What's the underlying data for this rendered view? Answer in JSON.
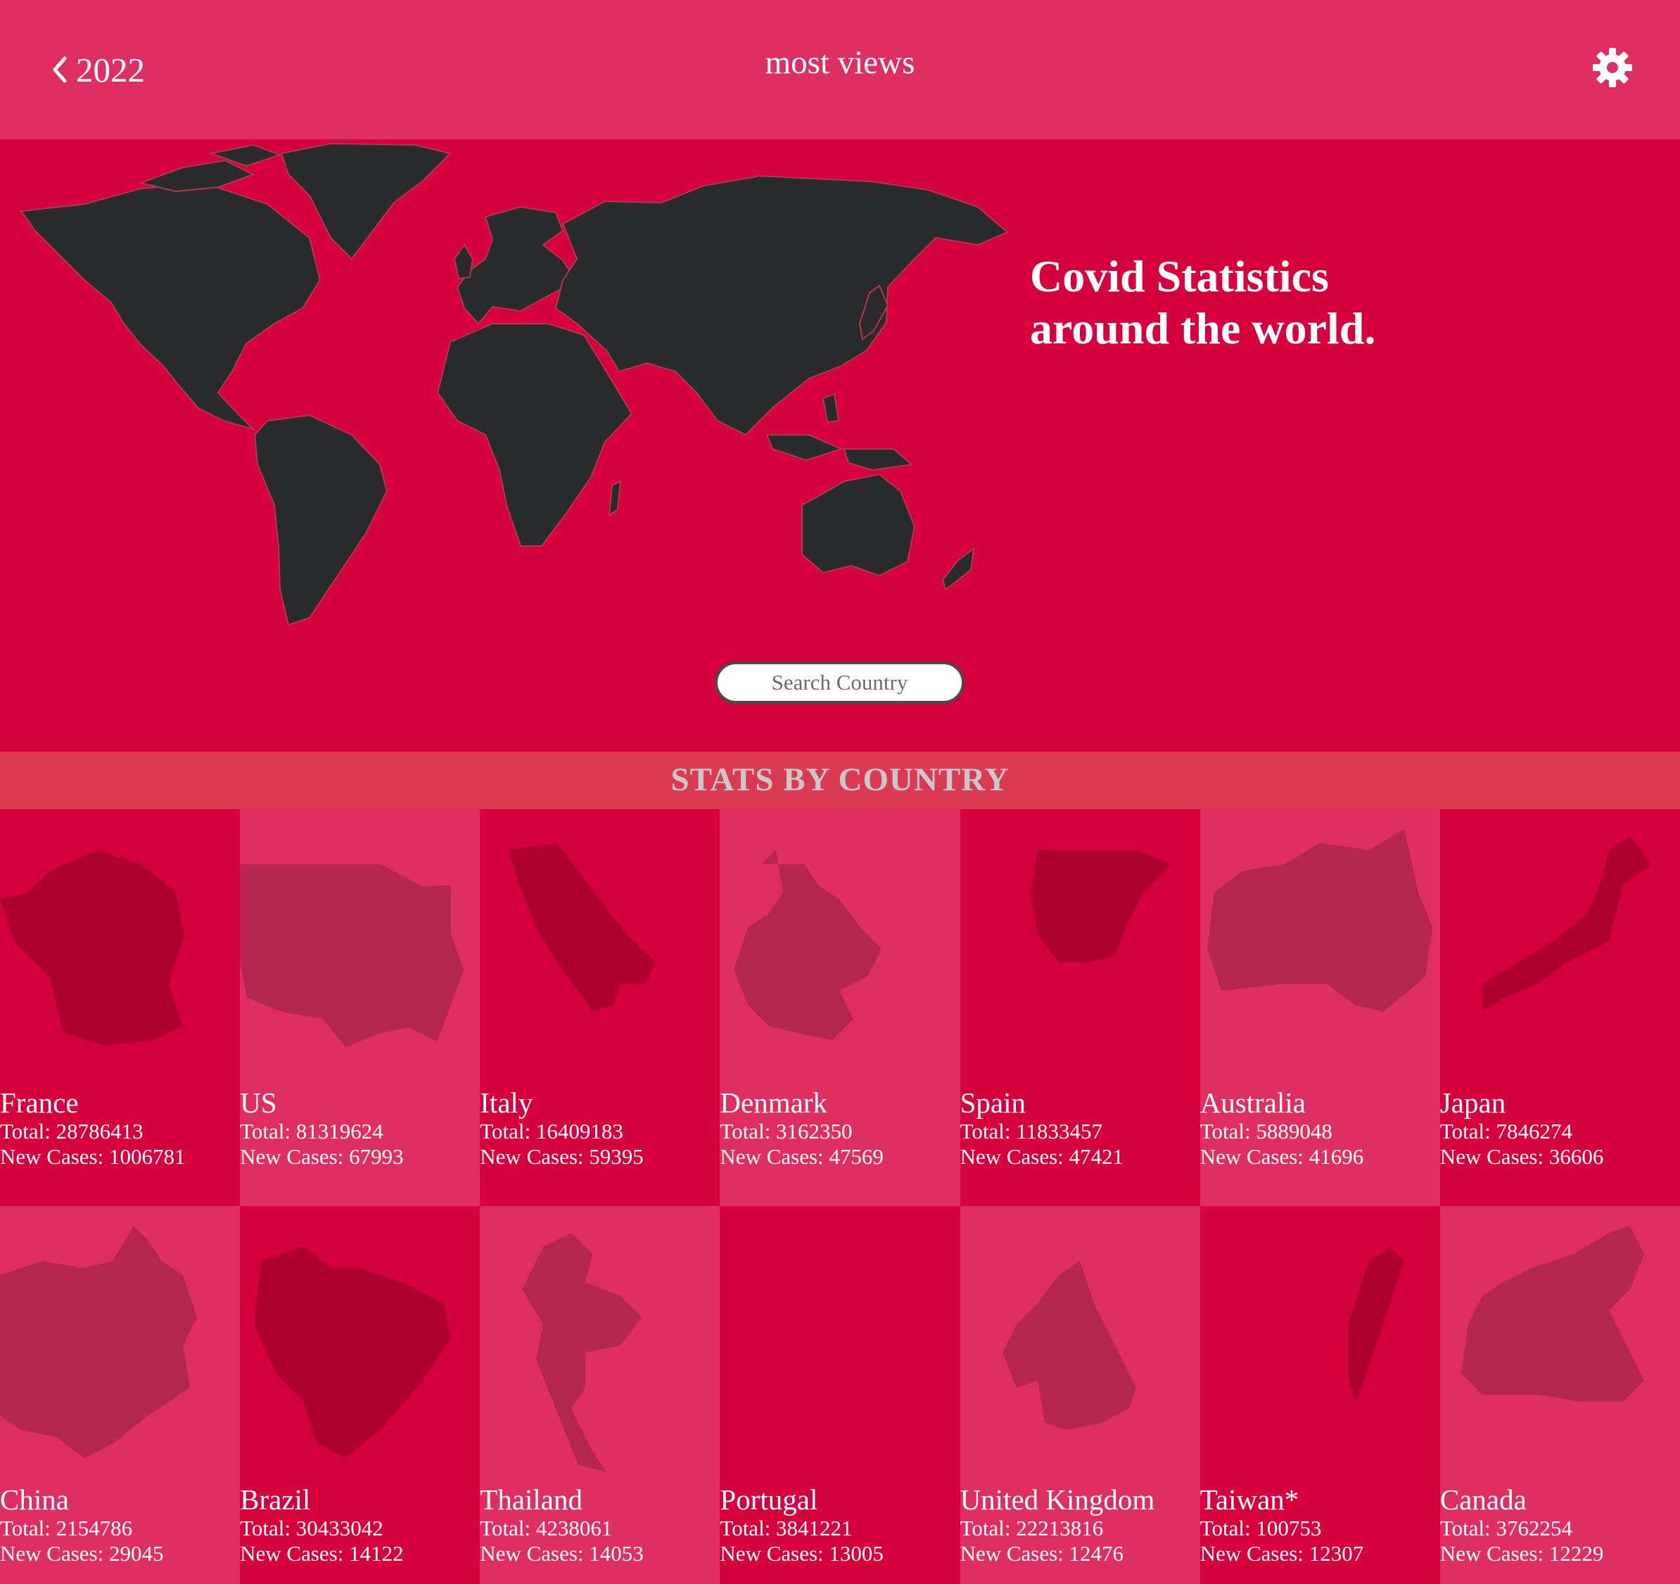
{
  "header": {
    "back_label": "2022",
    "title": "most views",
    "settings_icon": "gear-icon"
  },
  "hero": {
    "heading_line1": "Covid Statistics",
    "heading_line2": "around the world.",
    "search_placeholder": "Search Country"
  },
  "section_title": "STATS BY COUNTRY",
  "labels": {
    "total": "Total: ",
    "new_cases": "New Cases: "
  },
  "colors": {
    "header": "#df2e62",
    "hero": "#d6003f",
    "section_bar": "#da3a52",
    "section_text": "#c8c8c8",
    "map_land": "#2a2b2d",
    "silhouette_dark": "#ad002f",
    "silhouette_light": "#b32750"
  },
  "countries": [
    {
      "name": "France",
      "total": "28786413",
      "new_cases": "1006781"
    },
    {
      "name": "US",
      "total": "81319624",
      "new_cases": "67993"
    },
    {
      "name": "Italy",
      "total": "16409183",
      "new_cases": "59395"
    },
    {
      "name": "Denmark",
      "total": "3162350",
      "new_cases": "47569"
    },
    {
      "name": "Spain",
      "total": "11833457",
      "new_cases": "47421"
    },
    {
      "name": "Australia",
      "total": "5889048",
      "new_cases": "41696"
    },
    {
      "name": "Japan",
      "total": "7846274",
      "new_cases": "36606"
    },
    {
      "name": "China",
      "total": "2154786",
      "new_cases": "29045"
    },
    {
      "name": "Brazil",
      "total": "30433042",
      "new_cases": "14122"
    },
    {
      "name": "Thailand",
      "total": "4238061",
      "new_cases": "14053"
    },
    {
      "name": "Portugal",
      "total": "3841221",
      "new_cases": "13005"
    },
    {
      "name": "United Kingdom",
      "total": "22213816",
      "new_cases": "12476"
    },
    {
      "name": "Taiwan*",
      "total": "100753",
      "new_cases": "12307"
    },
    {
      "name": "Canada",
      "total": "3762254",
      "new_cases": "12229"
    }
  ]
}
